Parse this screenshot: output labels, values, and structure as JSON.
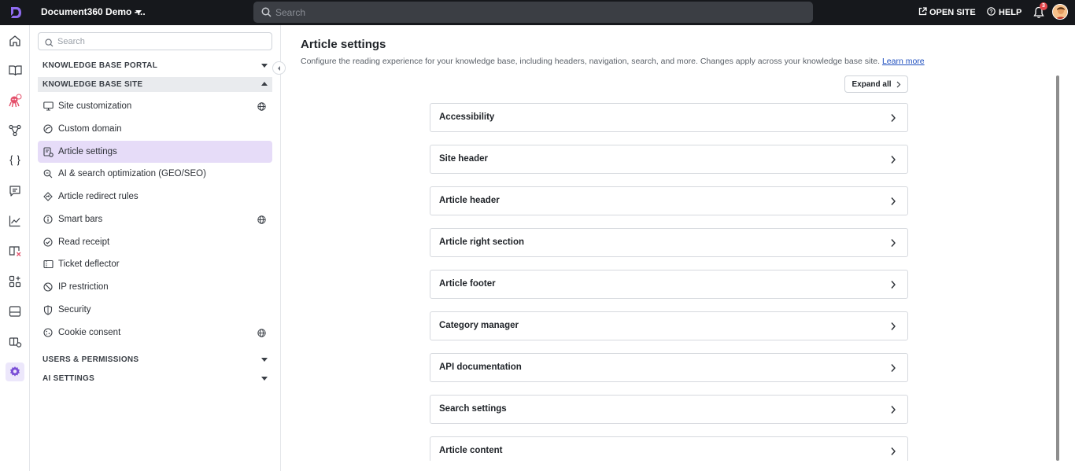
{
  "topbar": {
    "project_name": "Document360 Demo -...",
    "search_placeholder": "Search",
    "open_site_label": "OPEN SITE",
    "help_label": "HELP",
    "notification_count": "3"
  },
  "rail": {
    "icons": [
      "home-icon",
      "book-icon",
      "octopus-bot-icon",
      "workflow-icon",
      "api-braces-icon",
      "feedback-icon",
      "analytics-icon",
      "book-x-icon",
      "apps-icon",
      "drive-icon",
      "settings-book-icon",
      "gear-icon"
    ],
    "active": "gear-icon",
    "accent_color": "#7a4fd6"
  },
  "sidebar": {
    "search_placeholder": "Search",
    "sections": {
      "kb_portal": "KNOWLEDGE BASE PORTAL",
      "kb_site": "KNOWLEDGE BASE SITE",
      "users_permissions": "USERS & PERMISSIONS",
      "ai_settings": "AI SETTINGS"
    },
    "items": [
      {
        "label": "Site customization",
        "icon": "monitor-icon",
        "globe": true
      },
      {
        "label": "Custom domain",
        "icon": "domain-icon",
        "globe": false
      },
      {
        "label": "Article settings",
        "icon": "article-settings-icon",
        "globe": false,
        "active": true
      },
      {
        "label": "AI & search optimization (GEO/SEO)",
        "icon": "search-optimize-icon",
        "globe": false
      },
      {
        "label": "Article redirect rules",
        "icon": "redirect-icon",
        "globe": false
      },
      {
        "label": "Smart bars",
        "icon": "info-icon",
        "globe": true
      },
      {
        "label": "Read receipt",
        "icon": "check-circle-icon",
        "globe": false
      },
      {
        "label": "Ticket deflector",
        "icon": "ticket-icon",
        "globe": false
      },
      {
        "label": "IP restriction",
        "icon": "block-icon",
        "globe": false
      },
      {
        "label": "Security",
        "icon": "shield-icon",
        "globe": false
      },
      {
        "label": "Cookie consent",
        "icon": "cookie-icon",
        "globe": true
      }
    ]
  },
  "main": {
    "title": "Article settings",
    "description": "Configure the reading experience for your knowledge base, including headers, navigation, search, and more. Changes apply across your knowledge base site.",
    "learn_more": "Learn more",
    "expand_all": "Expand all",
    "sections": [
      "Accessibility",
      "Site header",
      "Article header",
      "Article right section",
      "Article footer",
      "Category manager",
      "API documentation",
      "Search settings",
      "Article content"
    ]
  }
}
